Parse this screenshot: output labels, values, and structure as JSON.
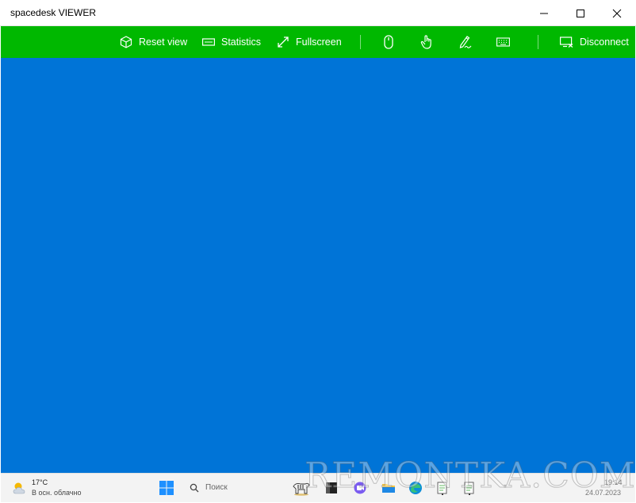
{
  "window": {
    "title": "spacedesk VIEWER"
  },
  "toolbar": {
    "reset_view": "Reset view",
    "statistics": "Statistics",
    "fullscreen": "Fullscreen",
    "disconnect": "Disconnect"
  },
  "colors": {
    "toolbar_bg": "#00b800",
    "desktop_bg": "#0074d7"
  },
  "taskbar": {
    "weather_temp": "17°C",
    "weather_condition": "В осн. облачно",
    "search_placeholder": "Поиск",
    "time": "19:14",
    "date": "24.07.2023"
  },
  "watermark": "REMONTKA.COM"
}
